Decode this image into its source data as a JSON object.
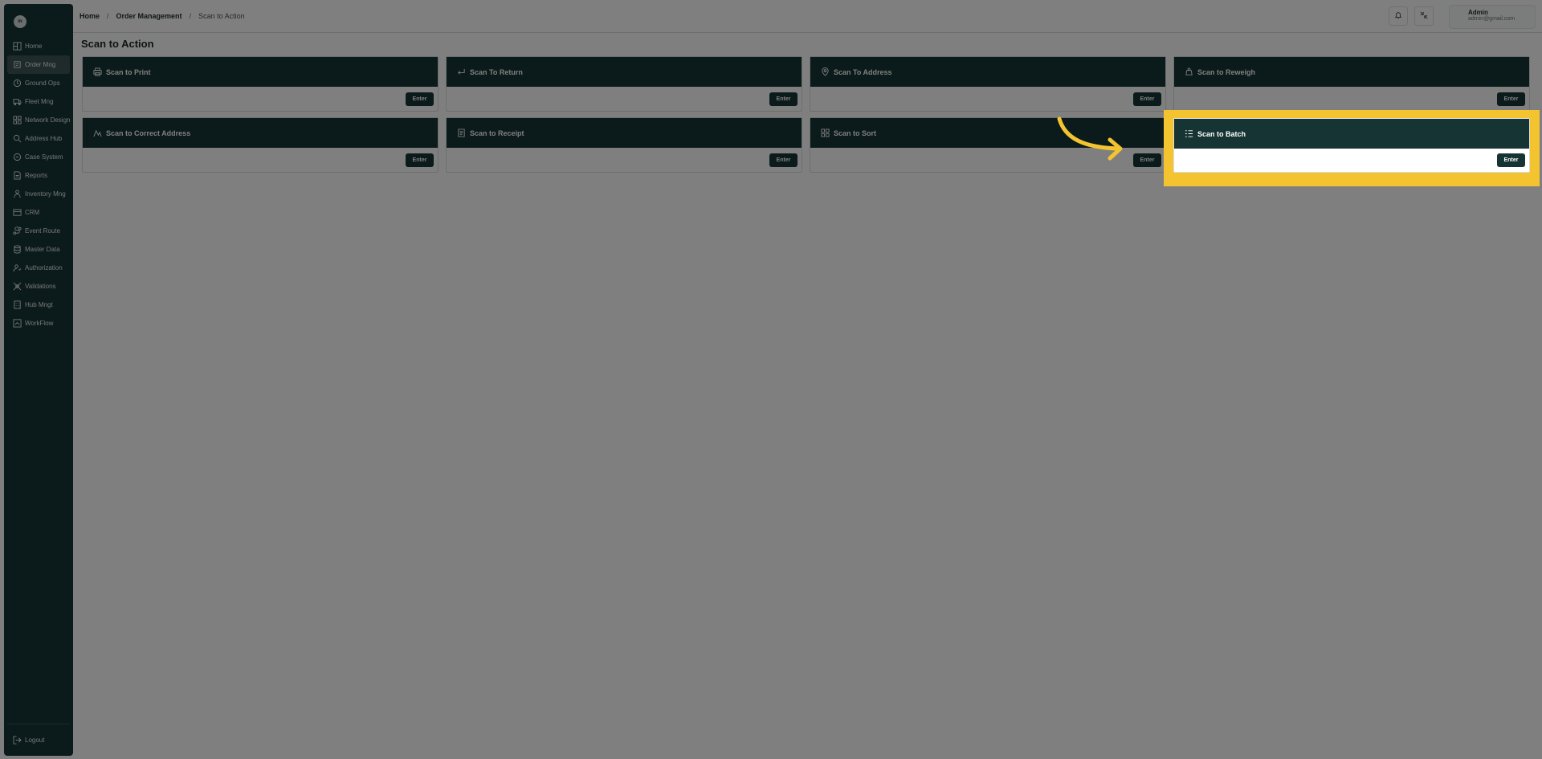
{
  "sidebar": {
    "logo_text": "in",
    "items": [
      {
        "label": "Home",
        "icon": "home-icon",
        "active": false
      },
      {
        "label": "Order Mng",
        "icon": "order-icon",
        "active": true
      },
      {
        "label": "Ground Ops",
        "icon": "ground-ops-icon",
        "active": false
      },
      {
        "label": "Fleet Mng",
        "icon": "fleet-icon",
        "active": false
      },
      {
        "label": "Network Design",
        "icon": "network-icon",
        "active": false
      },
      {
        "label": "Address Hub",
        "icon": "address-hub-icon",
        "active": false
      },
      {
        "label": "Case System",
        "icon": "case-icon",
        "active": false
      },
      {
        "label": "Reports",
        "icon": "reports-icon",
        "active": false
      },
      {
        "label": "Inventory Mng",
        "icon": "inventory-icon",
        "active": false
      },
      {
        "label": "CRM",
        "icon": "crm-icon",
        "active": false
      },
      {
        "label": "Event Route",
        "icon": "event-route-icon",
        "active": false
      },
      {
        "label": "Master Data",
        "icon": "master-data-icon",
        "active": false
      },
      {
        "label": "Authorization",
        "icon": "authorization-icon",
        "active": false
      },
      {
        "label": "Validations",
        "icon": "validations-icon",
        "active": false
      },
      {
        "label": "Hub Mngt",
        "icon": "hub-icon",
        "active": false
      },
      {
        "label": "WorkFlow",
        "icon": "workflow-icon",
        "active": false
      }
    ],
    "logout_label": "Logout"
  },
  "header": {
    "breadcrumb": [
      "Home",
      "Order Management",
      "Scan to Action"
    ],
    "user_name": "Admin",
    "user_email": "admin@gmail.com"
  },
  "page_title": "Scan to Action",
  "cards": [
    {
      "title": "Scan to Print",
      "icon": "printer-icon",
      "button": "Enter"
    },
    {
      "title": "Scan To Return",
      "icon": "return-arrow-icon",
      "button": "Enter"
    },
    {
      "title": "Scan To Address",
      "icon": "map-pin-icon",
      "button": "Enter"
    },
    {
      "title": "Scan to Reweigh",
      "icon": "weight-icon",
      "button": "Enter"
    },
    {
      "title": "Scan to Correct Address",
      "icon": "route-icon",
      "button": "Enter"
    },
    {
      "title": "Scan to Receipt",
      "icon": "receipt-icon",
      "button": "Enter"
    },
    {
      "title": "Scan to Sort",
      "icon": "sort-grid-icon",
      "button": "Enter"
    },
    {
      "title": "Scan to Batch",
      "icon": "batch-list-icon",
      "button": "Enter",
      "highlighted": true
    }
  ],
  "colors": {
    "sidebar_bg": "#173434",
    "card_header": "#173434",
    "highlight": "#f4c430",
    "overlay": "rgba(0,0,0,0.5)"
  }
}
